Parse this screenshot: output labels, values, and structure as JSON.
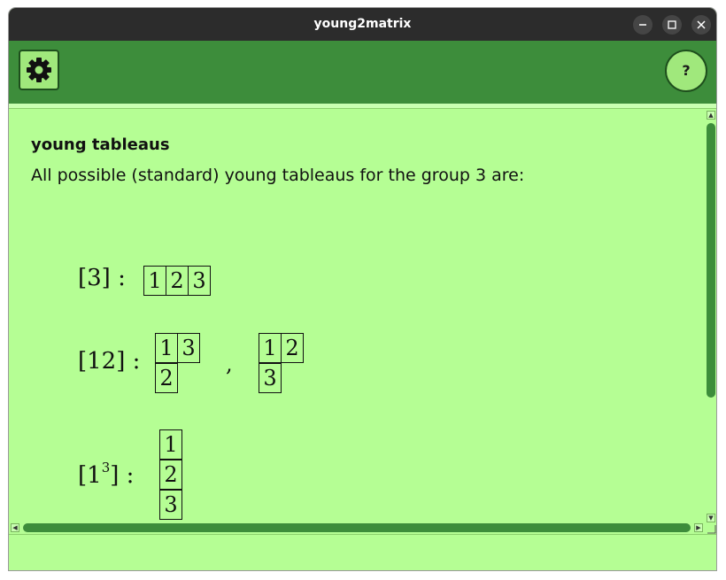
{
  "window": {
    "title": "young2matrix",
    "controls": {
      "minimize_icon": "minimize-icon",
      "maximize_icon": "maximize-icon",
      "close_icon": "close-icon"
    }
  },
  "toolbar": {
    "settings_icon": "gear-icon",
    "help_label": "?"
  },
  "content": {
    "heading": "young tableaus",
    "description": "All possible (standard) young tableaus for the group 3 are:",
    "partitions": [
      {
        "label": "[3] :",
        "tableaux": [
          [
            [
              "1",
              "2",
              "3"
            ]
          ]
        ]
      },
      {
        "label": "[12] :",
        "separator": ",",
        "tableaux": [
          [
            [
              "1",
              "3"
            ],
            [
              "2"
            ]
          ],
          [
            [
              "1",
              "2"
            ],
            [
              "3"
            ]
          ]
        ]
      },
      {
        "label_base": "[1",
        "label_exponent": "3",
        "label_tail": "] :",
        "tableaux": [
          [
            [
              "1"
            ],
            [
              "2"
            ],
            [
              "3"
            ]
          ]
        ]
      }
    ]
  },
  "colors": {
    "background": "#b5fe94",
    "toolbar": "#3d8d3b",
    "button": "#a0e87c",
    "titlebar": "#2c2c2c"
  }
}
